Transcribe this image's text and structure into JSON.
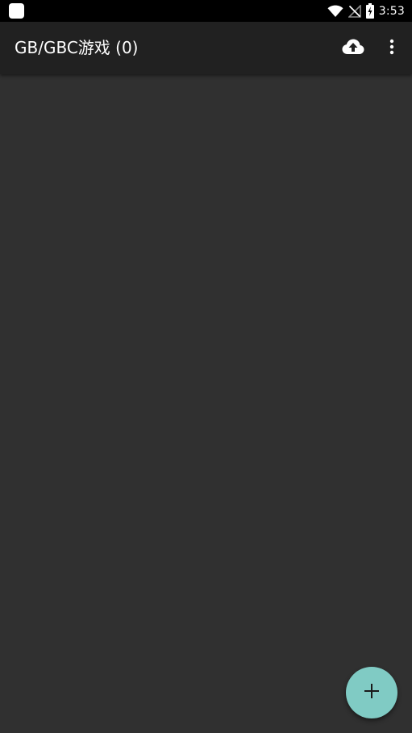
{
  "status_bar": {
    "time": "3:53",
    "icons": [
      "app-notification-icon",
      "wifi-icon",
      "no-signal-icon",
      "battery-charging-icon"
    ]
  },
  "app_bar": {
    "title": "GB/GBC游戏 (0)",
    "actions": [
      "cloud-upload-icon",
      "more-vert-icon"
    ]
  },
  "fab": {
    "icon": "plus-icon"
  },
  "colors": {
    "status_bar": "#000000",
    "app_bar": "#212121",
    "background": "#303030",
    "fab": "#80cbc4",
    "text": "#ffffff"
  }
}
